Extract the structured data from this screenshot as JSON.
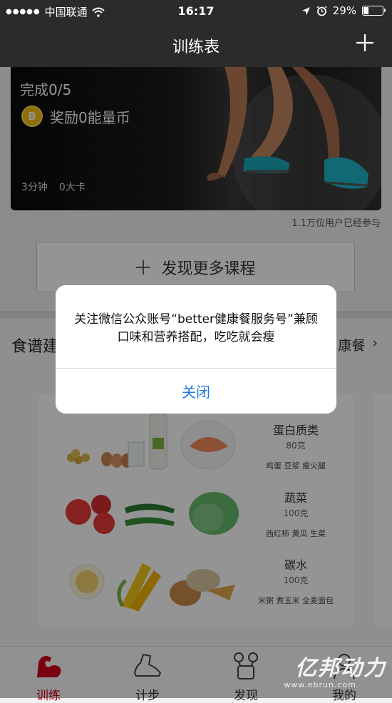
{
  "status": {
    "dots": "●●●●●",
    "carrier": "中国联通",
    "time": "16:17",
    "battery": "29%"
  },
  "nav": {
    "title": "训练表",
    "add_icon": "plus-icon"
  },
  "hero": {
    "progress": "完成0/5",
    "coin_letter": "B",
    "reward": "奖励0能量币",
    "duration": "3分钟",
    "calories": "0大卡"
  },
  "participants": "1.1万位用户已经参与",
  "discover": {
    "label": "发现更多课程"
  },
  "recipe": {
    "title": "食谱建",
    "more": "康餐",
    "rows": [
      {
        "name": "蛋白质类",
        "amount": "80克",
        "examples": "鸡蛋  豆浆  瘦火腿"
      },
      {
        "name": "蔬菜",
        "amount": "100克",
        "examples": "西红柿 黄瓜 生菜"
      },
      {
        "name": "碳水",
        "amount": "100克",
        "examples": "米粥 煮玉米 全麦面包"
      }
    ]
  },
  "tabs": [
    {
      "label": "训练",
      "icon": "muscle-arm-icon",
      "active": true
    },
    {
      "label": "计步",
      "icon": "sneaker-icon",
      "active": false
    },
    {
      "label": "发现",
      "icon": "kettlebell-icon",
      "active": false
    },
    {
      "label": "我的",
      "icon": "profile-icon",
      "active": false
    }
  ],
  "dialog": {
    "message": "关注微信公众账号“better健康餐服务号”兼顾口味和营养搭配，吃吃就会瘦",
    "close": "关闭"
  },
  "watermark": {
    "main": "亿邦动力",
    "sub": "www.ebrun.com"
  },
  "colors": {
    "nav_bg": "#2b2b2b",
    "accent_red": "#d0021b",
    "dialog_button": "#1f7ae0",
    "coin": "#f4c20d"
  }
}
